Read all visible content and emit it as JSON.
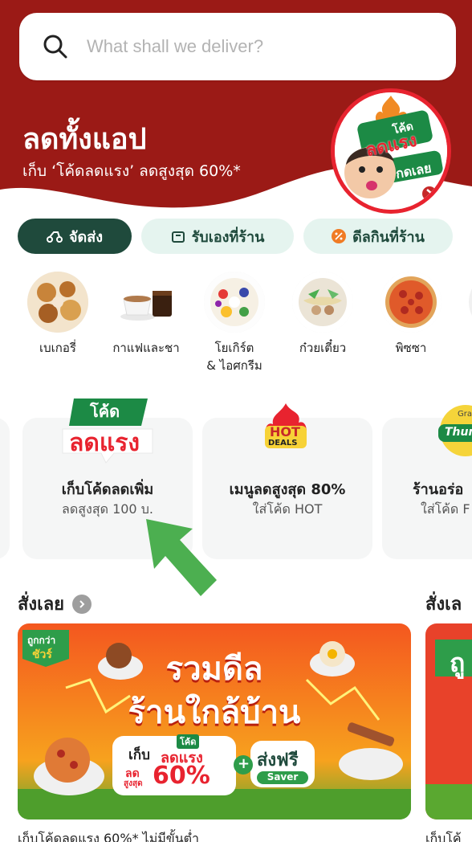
{
  "search": {
    "placeholder": "What shall we deliver?",
    "icon": "search-icon"
  },
  "hero": {
    "title": "ลดทั้งแอป",
    "subtitle": "เก็บ ‘โค้ดลดแรง’ ลดสูงสุด 60%*",
    "badge": {
      "line1": "โค้ด",
      "line2": "ลดแรง",
      "cta": "กดเลย"
    },
    "color": "#9b1a16"
  },
  "tabs": [
    {
      "label": "จัดส่ง",
      "icon": "scooter-icon",
      "active": true
    },
    {
      "label": "รับเองที่ร้าน",
      "icon": "bag-icon",
      "active": false
    },
    {
      "label": "ดีลกินที่ร้าน",
      "icon": "percent-icon",
      "active": false
    }
  ],
  "categories": [
    {
      "label": "เบเกอรี่",
      "icon": "bakery-image"
    },
    {
      "label": "กาแฟและชา",
      "icon": "coffee-image"
    },
    {
      "label": "โยเกิร์ต\n& ไอศกรีม",
      "icon": "yogurt-image"
    },
    {
      "label": "ก๋วยเตี๋ยว",
      "icon": "noodle-image"
    },
    {
      "label": "พิซซา",
      "icon": "pizza-image"
    }
  ],
  "deals": [
    {
      "logo_line1": "โค้ด",
      "logo_line2": "ลดแรง",
      "title": "เก็บโค้ดลดเพิ่ม",
      "subtitle": "ลดสูงสุด 100 บ."
    },
    {
      "logo_line1": "HOT",
      "logo_line2": "DEALS",
      "title": "เมนูลดสูงสุด 80%",
      "subtitle": "ใส่โค้ด HOT"
    },
    {
      "logo_line1": "Gra",
      "logo_line2": "Thum",
      "title": "ร้านอร่อ",
      "subtitle": "ใส่โค้ด F"
    }
  ],
  "section": {
    "title": "สั่งเลย",
    "title2": "สั่งเล"
  },
  "banner": {
    "corner_badge_line1": "ถูกกว่า",
    "corner_badge_line2": "ชัวร์",
    "headline1": "รวมดีล",
    "headline2": "ร้านใกล้บ้าน",
    "collect": "เก็บ",
    "code_line1": "โค้ด",
    "code_line2": "ลดแรง",
    "max_label1": "ลด",
    "max_label2": "สูงสุด",
    "percent": "60%",
    "plus": "+",
    "free_shipping": "ส่งฟรี",
    "saver": "Saver",
    "banner2_char": "ถู"
  },
  "footer": {
    "text1": "เก็บโค้ดลดแรง 60%* ไม่มีขั้นต่ำ",
    "text2": "เก็บโค้"
  },
  "colors": {
    "brand_green": "#1f4a3c",
    "tab_light": "#e5f4ef",
    "hero_red": "#9b1a16",
    "accent_red": "#e8232f",
    "arrow_green": "#4caf50"
  }
}
